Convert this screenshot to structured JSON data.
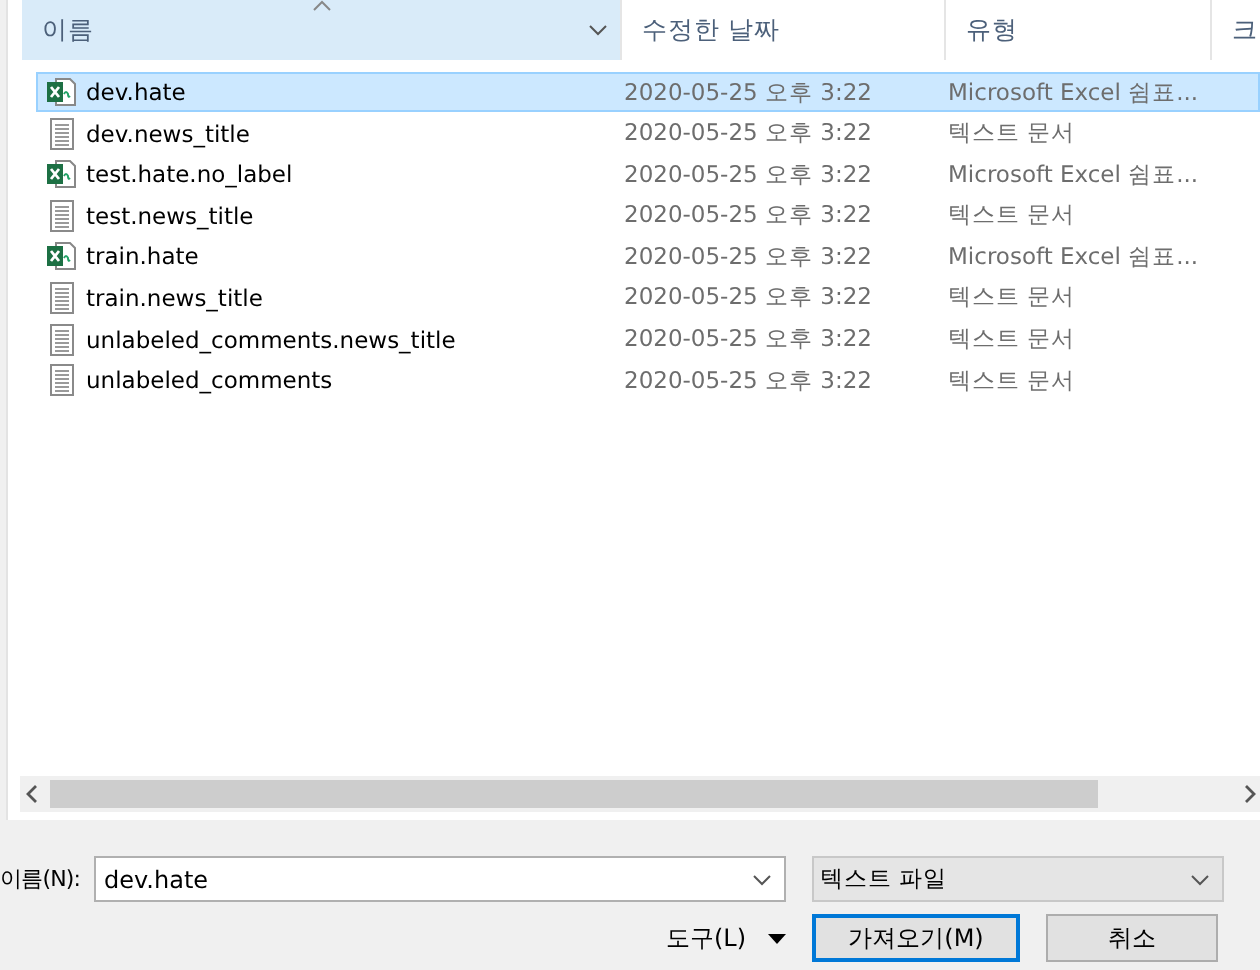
{
  "columns": [
    {
      "label": "이름",
      "sorted": true
    },
    {
      "label": "수정한 날짜",
      "sorted": false
    },
    {
      "label": "유형",
      "sorted": false
    },
    {
      "label": "크",
      "sorted": false
    }
  ],
  "files": [
    {
      "name": "dev.hate",
      "date": "2020-05-25 오후 3:22",
      "type": "Microsoft Excel 쉼표...",
      "kind": "excel",
      "selected": true
    },
    {
      "name": "dev.news_title",
      "date": "2020-05-25 오후 3:22",
      "type": "텍스트 문서",
      "kind": "text",
      "selected": false
    },
    {
      "name": "test.hate.no_label",
      "date": "2020-05-25 오후 3:22",
      "type": "Microsoft Excel 쉼표...",
      "kind": "excel",
      "selected": false
    },
    {
      "name": "test.news_title",
      "date": "2020-05-25 오후 3:22",
      "type": "텍스트 문서",
      "kind": "text",
      "selected": false
    },
    {
      "name": "train.hate",
      "date": "2020-05-25 오후 3:22",
      "type": "Microsoft Excel 쉼표...",
      "kind": "excel",
      "selected": false
    },
    {
      "name": "train.news_title",
      "date": "2020-05-25 오후 3:22",
      "type": "텍스트 문서",
      "kind": "text",
      "selected": false
    },
    {
      "name": "unlabeled_comments.news_title",
      "date": "2020-05-25 오후 3:22",
      "type": "텍스트 문서",
      "kind": "text",
      "selected": false
    },
    {
      "name": "unlabeled_comments",
      "date": "2020-05-25 오후 3:22",
      "type": "텍스트 문서",
      "kind": "text",
      "selected": false
    }
  ],
  "footer": {
    "filename_label": "이름(N):",
    "filename_value": "dev.hate",
    "filetype": "텍스트 파일",
    "tools_label": "도구(L)",
    "buttons": [
      {
        "label": "가져오기(M)",
        "default": true
      },
      {
        "label": "취소",
        "default": false
      }
    ]
  }
}
